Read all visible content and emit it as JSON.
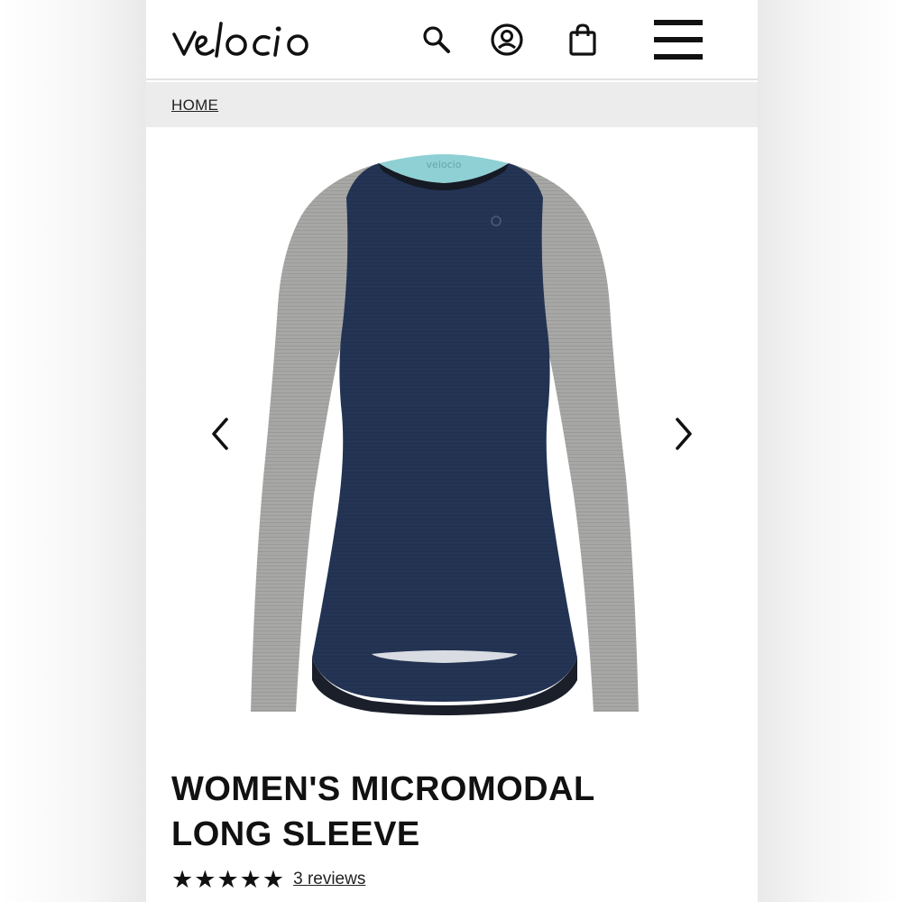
{
  "header": {
    "logo_text": "velocio",
    "icons": [
      "search-icon",
      "account-icon",
      "shopping-bag-icon",
      "menu-icon"
    ]
  },
  "breadcrumb": {
    "home_label": "HOME"
  },
  "gallery": {
    "prev_icon": "chevron-left-icon",
    "next_icon": "chevron-right-icon",
    "colors": {
      "body": "#243454",
      "sleeves": "#a7a7a5",
      "collar": "#8fd0d4"
    }
  },
  "product": {
    "title_line1": "WOMEN'S MICROMODAL",
    "title_line2": "LONG SLEEVE",
    "rating_stars": 5,
    "reviews_label": "3 reviews"
  }
}
